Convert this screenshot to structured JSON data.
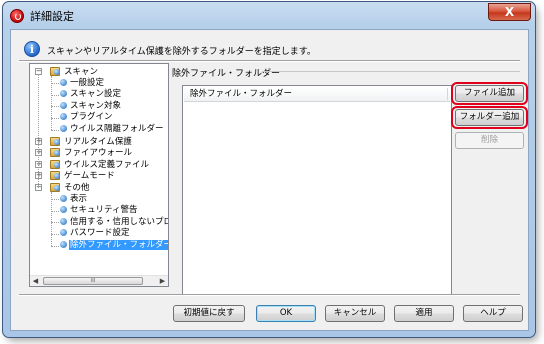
{
  "window": {
    "title": "詳細設定",
    "close_label": "X"
  },
  "info": {
    "text": "スキャンやリアルタイム保護を除外するフォルダーを指定します。"
  },
  "tree": {
    "items": [
      {
        "label": "スキャン",
        "level": 0,
        "type": "group",
        "expanded": true
      },
      {
        "label": "一般設定",
        "level": 1,
        "type": "leaf"
      },
      {
        "label": "スキャン設定",
        "level": 1,
        "type": "leaf"
      },
      {
        "label": "スキャン対象",
        "level": 1,
        "type": "leaf"
      },
      {
        "label": "プラグイン",
        "level": 1,
        "type": "leaf"
      },
      {
        "label": "ウイルス隔離フォルダー",
        "level": 1,
        "type": "leaf"
      },
      {
        "label": "リアルタイム保護",
        "level": 0,
        "type": "group",
        "expanded": false
      },
      {
        "label": "ファイアウォール",
        "level": 0,
        "type": "group",
        "expanded": false
      },
      {
        "label": "ウイルス定義ファイル",
        "level": 0,
        "type": "group",
        "expanded": false
      },
      {
        "label": "ゲームモード",
        "level": 0,
        "type": "group",
        "expanded": false
      },
      {
        "label": "その他",
        "level": 0,
        "type": "group",
        "expanded": true
      },
      {
        "label": "表示",
        "level": 1,
        "type": "leaf"
      },
      {
        "label": "セキュリティ警告",
        "level": 1,
        "type": "leaf"
      },
      {
        "label": "信用する・信用しないプロ",
        "level": 1,
        "type": "leaf"
      },
      {
        "label": "パスワード設定",
        "level": 1,
        "type": "leaf"
      },
      {
        "label": "除外ファイル・フォルダー",
        "level": 1,
        "type": "leaf",
        "selected": true
      }
    ],
    "scroll_grip": "III"
  },
  "section": {
    "title": "除外ファイル・フォルダー",
    "list_header": "除外ファイル・フォルダー"
  },
  "side_buttons": {
    "add_file": "ファイル追加",
    "add_folder": "フォルダー追加",
    "delete": "削除"
  },
  "bottom_buttons": {
    "reset": "初期値に戻す",
    "ok": "OK",
    "cancel": "キャンセル",
    "apply": "適用",
    "help": "ヘルプ"
  },
  "colors": {
    "highlight_ring": "#e0001b",
    "selection": "#3399ff"
  }
}
